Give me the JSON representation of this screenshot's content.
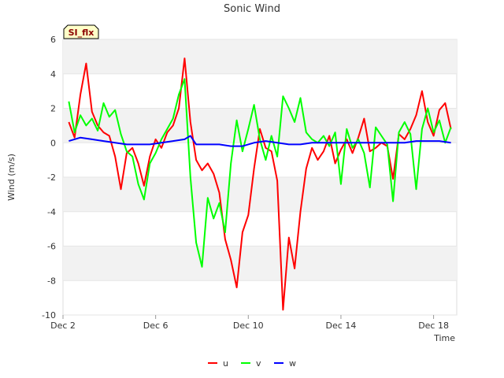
{
  "chart_data": {
    "type": "line",
    "title": "Sonic Wind",
    "badge": "SI_flx",
    "xlabel": "Time",
    "ylabel": "Wind (m/s)",
    "ylim": [
      -10,
      6
    ],
    "yticks": [
      -10,
      -8,
      -6,
      -4,
      -2,
      0,
      2,
      4,
      6
    ],
    "xlim": [
      "2023-12-02",
      "2023-12-19"
    ],
    "xticks": [
      {
        "date": "2023-12-02",
        "label": "Dec 2"
      },
      {
        "date": "2023-12-06",
        "label": "Dec 6"
      },
      {
        "date": "2023-12-10",
        "label": "Dec 10"
      },
      {
        "date": "2023-12-14",
        "label": "Dec 14"
      },
      {
        "date": "2023-12-18",
        "label": "Dec 18"
      }
    ],
    "legend_position": "bottom-center",
    "series": [
      {
        "name": "u",
        "color": "#ff0000",
        "points": [
          [
            "2023-12-02T06:00",
            1.2
          ],
          [
            "2023-12-02T12:00",
            0.3
          ],
          [
            "2023-12-02T18:00",
            2.8
          ],
          [
            "2023-12-03T00:00",
            4.6
          ],
          [
            "2023-12-03T06:00",
            1.8
          ],
          [
            "2023-12-03T12:00",
            1.0
          ],
          [
            "2023-12-03T18:00",
            0.6
          ],
          [
            "2023-12-04T00:00",
            0.4
          ],
          [
            "2023-12-04T06:00",
            -0.8
          ],
          [
            "2023-12-04T12:00",
            -2.7
          ],
          [
            "2023-12-04T18:00",
            -0.6
          ],
          [
            "2023-12-05T00:00",
            -0.3
          ],
          [
            "2023-12-05T06:00",
            -1.2
          ],
          [
            "2023-12-05T12:00",
            -2.5
          ],
          [
            "2023-12-05T18:00",
            -0.8
          ],
          [
            "2023-12-06T00:00",
            0.2
          ],
          [
            "2023-12-06T06:00",
            -0.3
          ],
          [
            "2023-12-06T12:00",
            0.6
          ],
          [
            "2023-12-06T18:00",
            1.0
          ],
          [
            "2023-12-07T00:00",
            2.0
          ],
          [
            "2023-12-07T06:00",
            4.9
          ],
          [
            "2023-12-07T12:00",
            1.2
          ],
          [
            "2023-12-07T18:00",
            -1.0
          ],
          [
            "2023-12-08T00:00",
            -1.6
          ],
          [
            "2023-12-08T06:00",
            -1.2
          ],
          [
            "2023-12-08T12:00",
            -1.8
          ],
          [
            "2023-12-08T18:00",
            -2.9
          ],
          [
            "2023-12-09T00:00",
            -5.6
          ],
          [
            "2023-12-09T06:00",
            -6.8
          ],
          [
            "2023-12-09T12:00",
            -8.4
          ],
          [
            "2023-12-09T18:00",
            -5.2
          ],
          [
            "2023-12-10T00:00",
            -4.2
          ],
          [
            "2023-12-10T06:00",
            -1.5
          ],
          [
            "2023-12-10T12:00",
            0.8
          ],
          [
            "2023-12-10T18:00",
            -0.3
          ],
          [
            "2023-12-11T00:00",
            -0.5
          ],
          [
            "2023-12-11T06:00",
            -2.2
          ],
          [
            "2023-12-11T12:00",
            -9.7
          ],
          [
            "2023-12-11T18:00",
            -5.5
          ],
          [
            "2023-12-12T00:00",
            -7.3
          ],
          [
            "2023-12-12T06:00",
            -4.0
          ],
          [
            "2023-12-12T12:00",
            -1.5
          ],
          [
            "2023-12-12T18:00",
            -0.3
          ],
          [
            "2023-12-13T00:00",
            -1.0
          ],
          [
            "2023-12-13T06:00",
            -0.5
          ],
          [
            "2023-12-13T12:00",
            0.4
          ],
          [
            "2023-12-13T18:00",
            -1.2
          ],
          [
            "2023-12-14T00:00",
            -0.4
          ],
          [
            "2023-12-14T06:00",
            0.2
          ],
          [
            "2023-12-14T12:00",
            -0.6
          ],
          [
            "2023-12-14T18:00",
            0.3
          ],
          [
            "2023-12-15T00:00",
            1.4
          ],
          [
            "2023-12-15T06:00",
            -0.5
          ],
          [
            "2023-12-15T12:00",
            -0.3
          ],
          [
            "2023-12-15T18:00",
            0.0
          ],
          [
            "2023-12-16T00:00",
            -0.2
          ],
          [
            "2023-12-16T06:00",
            -2.1
          ],
          [
            "2023-12-16T12:00",
            0.5
          ],
          [
            "2023-12-16T18:00",
            0.2
          ],
          [
            "2023-12-17T00:00",
            0.8
          ],
          [
            "2023-12-17T06:00",
            1.6
          ],
          [
            "2023-12-17T12:00",
            3.0
          ],
          [
            "2023-12-17T18:00",
            1.2
          ],
          [
            "2023-12-18T00:00",
            0.4
          ],
          [
            "2023-12-18T06:00",
            1.9
          ],
          [
            "2023-12-18T12:00",
            2.3
          ],
          [
            "2023-12-18T18:00",
            0.8
          ]
        ]
      },
      {
        "name": "v",
        "color": "#00ff00",
        "points": [
          [
            "2023-12-02T06:00",
            2.4
          ],
          [
            "2023-12-02T12:00",
            0.6
          ],
          [
            "2023-12-02T18:00",
            1.6
          ],
          [
            "2023-12-03T00:00",
            1.0
          ],
          [
            "2023-12-03T06:00",
            1.4
          ],
          [
            "2023-12-03T12:00",
            0.7
          ],
          [
            "2023-12-03T18:00",
            2.3
          ],
          [
            "2023-12-04T00:00",
            1.5
          ],
          [
            "2023-12-04T06:00",
            1.9
          ],
          [
            "2023-12-04T12:00",
            0.5
          ],
          [
            "2023-12-04T18:00",
            -0.5
          ],
          [
            "2023-12-05T00:00",
            -0.8
          ],
          [
            "2023-12-05T06:00",
            -2.4
          ],
          [
            "2023-12-05T12:00",
            -3.3
          ],
          [
            "2023-12-05T18:00",
            -1.2
          ],
          [
            "2023-12-06T00:00",
            -0.6
          ],
          [
            "2023-12-06T06:00",
            0.2
          ],
          [
            "2023-12-06T12:00",
            0.8
          ],
          [
            "2023-12-06T18:00",
            1.4
          ],
          [
            "2023-12-07T00:00",
            2.8
          ],
          [
            "2023-12-07T06:00",
            3.7
          ],
          [
            "2023-12-07T12:00",
            -2.0
          ],
          [
            "2023-12-07T18:00",
            -5.8
          ],
          [
            "2023-12-08T00:00",
            -7.2
          ],
          [
            "2023-12-08T06:00",
            -3.2
          ],
          [
            "2023-12-08T12:00",
            -4.4
          ],
          [
            "2023-12-08T18:00",
            -3.5
          ],
          [
            "2023-12-09T00:00",
            -5.2
          ],
          [
            "2023-12-09T06:00",
            -1.2
          ],
          [
            "2023-12-09T12:00",
            1.3
          ],
          [
            "2023-12-09T18:00",
            -0.5
          ],
          [
            "2023-12-10T00:00",
            0.8
          ],
          [
            "2023-12-10T06:00",
            2.2
          ],
          [
            "2023-12-10T12:00",
            0.2
          ],
          [
            "2023-12-10T18:00",
            -1.0
          ],
          [
            "2023-12-11T00:00",
            0.4
          ],
          [
            "2023-12-11T06:00",
            -0.8
          ],
          [
            "2023-12-11T12:00",
            2.7
          ],
          [
            "2023-12-11T18:00",
            2.0
          ],
          [
            "2023-12-12T00:00",
            1.2
          ],
          [
            "2023-12-12T06:00",
            2.6
          ],
          [
            "2023-12-12T12:00",
            0.6
          ],
          [
            "2023-12-12T18:00",
            0.2
          ],
          [
            "2023-12-13T00:00",
            0.0
          ],
          [
            "2023-12-13T06:00",
            0.4
          ],
          [
            "2023-12-13T12:00",
            -0.2
          ],
          [
            "2023-12-13T18:00",
            0.6
          ],
          [
            "2023-12-14T00:00",
            -2.4
          ],
          [
            "2023-12-14T06:00",
            0.8
          ],
          [
            "2023-12-14T12:00",
            -0.3
          ],
          [
            "2023-12-14T18:00",
            0.2
          ],
          [
            "2023-12-15T00:00",
            -0.6
          ],
          [
            "2023-12-15T06:00",
            -2.6
          ],
          [
            "2023-12-15T12:00",
            0.9
          ],
          [
            "2023-12-15T18:00",
            0.4
          ],
          [
            "2023-12-16T00:00",
            -0.1
          ],
          [
            "2023-12-16T06:00",
            -3.4
          ],
          [
            "2023-12-16T12:00",
            0.6
          ],
          [
            "2023-12-16T18:00",
            1.2
          ],
          [
            "2023-12-17T00:00",
            0.5
          ],
          [
            "2023-12-17T06:00",
            -2.7
          ],
          [
            "2023-12-17T12:00",
            0.8
          ],
          [
            "2023-12-17T18:00",
            2.0
          ],
          [
            "2023-12-18T00:00",
            0.6
          ],
          [
            "2023-12-18T06:00",
            1.3
          ],
          [
            "2023-12-18T12:00",
            0.0
          ],
          [
            "2023-12-18T18:00",
            0.9
          ]
        ]
      },
      {
        "name": "w",
        "color": "#0000ff",
        "points": [
          [
            "2023-12-02T06:00",
            0.1
          ],
          [
            "2023-12-02T18:00",
            0.3
          ],
          [
            "2023-12-03T06:00",
            0.2
          ],
          [
            "2023-12-03T18:00",
            0.1
          ],
          [
            "2023-12-04T06:00",
            0.0
          ],
          [
            "2023-12-04T18:00",
            -0.1
          ],
          [
            "2023-12-05T06:00",
            -0.1
          ],
          [
            "2023-12-05T18:00",
            -0.1
          ],
          [
            "2023-12-06T06:00",
            0.0
          ],
          [
            "2023-12-06T18:00",
            0.1
          ],
          [
            "2023-12-07T06:00",
            0.2
          ],
          [
            "2023-12-07T12:00",
            0.4
          ],
          [
            "2023-12-07T18:00",
            -0.1
          ],
          [
            "2023-12-08T06:00",
            -0.1
          ],
          [
            "2023-12-08T18:00",
            -0.1
          ],
          [
            "2023-12-09T06:00",
            -0.2
          ],
          [
            "2023-12-09T18:00",
            -0.2
          ],
          [
            "2023-12-10T06:00",
            0.0
          ],
          [
            "2023-12-10T18:00",
            0.1
          ],
          [
            "2023-12-11T06:00",
            0.0
          ],
          [
            "2023-12-11T18:00",
            -0.1
          ],
          [
            "2023-12-12T06:00",
            -0.1
          ],
          [
            "2023-12-12T18:00",
            0.0
          ],
          [
            "2023-12-13T06:00",
            0.0
          ],
          [
            "2023-12-13T18:00",
            0.0
          ],
          [
            "2023-12-14T06:00",
            0.0
          ],
          [
            "2023-12-14T18:00",
            0.0
          ],
          [
            "2023-12-15T06:00",
            0.0
          ],
          [
            "2023-12-15T18:00",
            0.0
          ],
          [
            "2023-12-16T06:00",
            0.0
          ],
          [
            "2023-12-16T18:00",
            0.0
          ],
          [
            "2023-12-17T06:00",
            0.1
          ],
          [
            "2023-12-17T18:00",
            0.1
          ],
          [
            "2023-12-18T06:00",
            0.1
          ],
          [
            "2023-12-18T18:00",
            0.0
          ]
        ]
      }
    ]
  }
}
